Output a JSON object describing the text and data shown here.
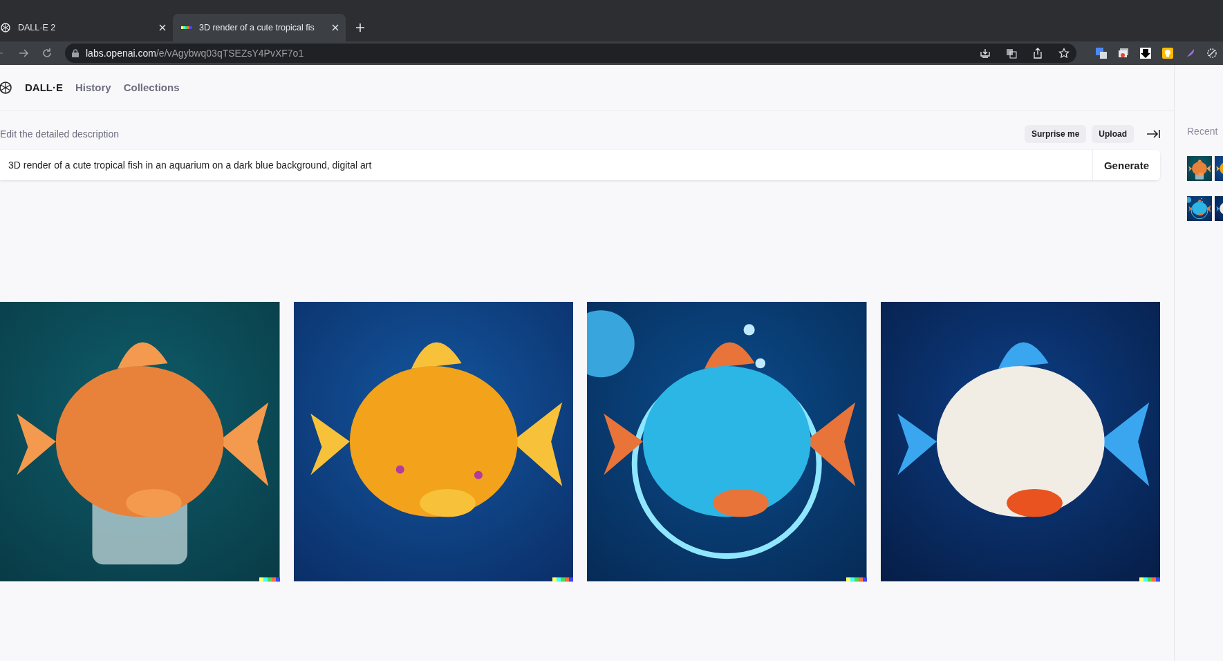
{
  "browser": {
    "tabs": [
      {
        "title": "DALL·E 2",
        "selected": false,
        "kind": "logo"
      },
      {
        "title": "3D render of a cute tropical fis",
        "selected": true,
        "kind": "strip"
      }
    ],
    "url": {
      "host": "labs.openai.com",
      "path": "/e/vAgybwq03qTSEZsY4PvXF7o1"
    }
  },
  "header": {
    "brand": "DALL·E",
    "nav": [
      {
        "label": "History",
        "selected": false
      },
      {
        "label": "Collections",
        "selected": false
      }
    ]
  },
  "prompt": {
    "label": "Edit the detailed description",
    "buttons": [
      "Surprise me",
      "Upload"
    ],
    "value": "3D render of a cute tropical fish in an aquarium on a dark blue background, digital art",
    "submit": "Generate"
  },
  "sidebar": {
    "title": "Recent"
  }
}
